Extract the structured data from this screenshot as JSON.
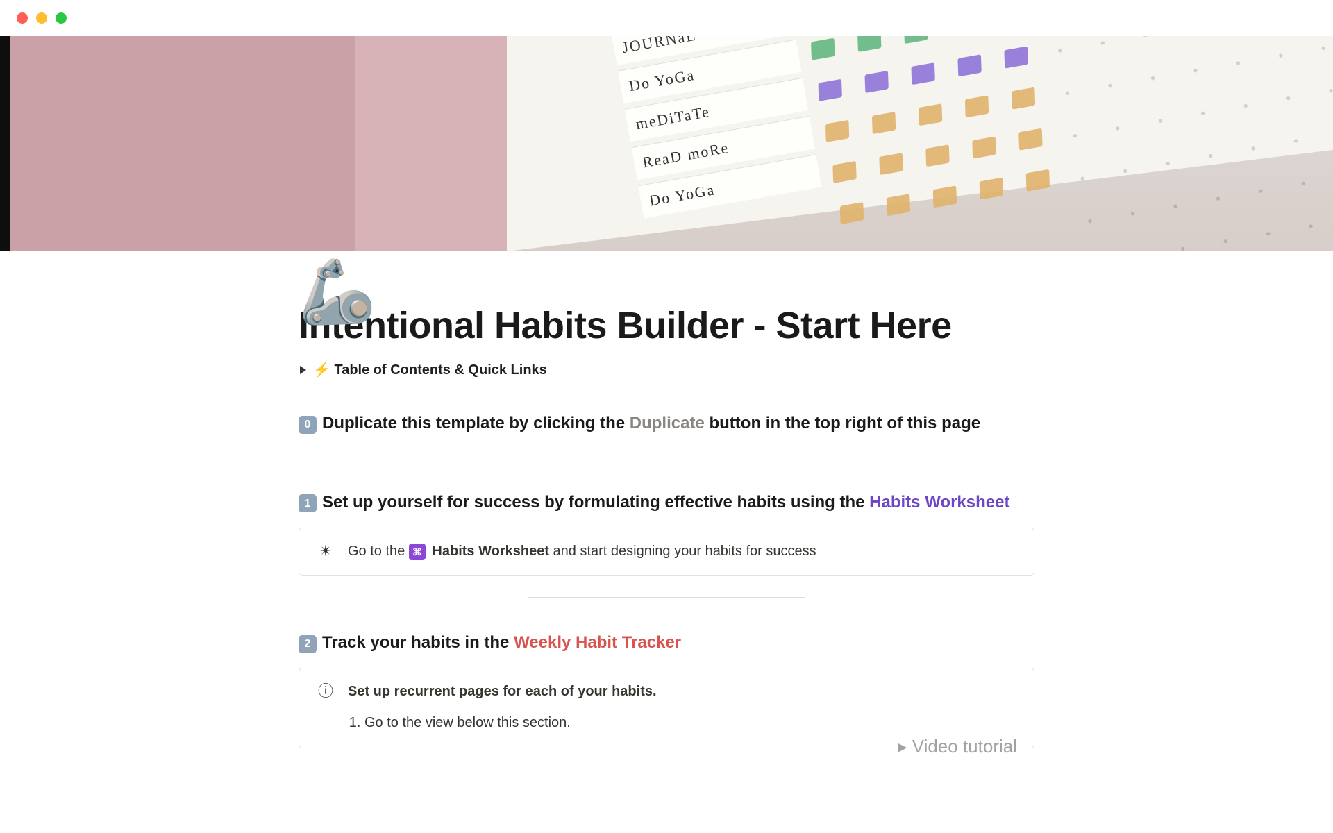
{
  "cover": {
    "journal_words": [
      "JOURNaL",
      "Do YoGa",
      "meDiTaTe",
      "ReaD moRe",
      "Do YoGa"
    ]
  },
  "page_icon": "🦾",
  "page_title": "Intentional Habits Builder - Start Here",
  "toc_toggle": "⚡ Table of Contents & Quick Links",
  "step0": {
    "num": "0",
    "pre": "Duplicate this template by clicking the ",
    "kw": "Duplicate",
    "post": " button in the top right of this page"
  },
  "step1": {
    "num": "1",
    "pre": "Set up yourself for success by formulating effective habits using the ",
    "link": "Habits Worksheet"
  },
  "step1_callout": {
    "lead": "Go to the ",
    "ws_name": "Habits Worksheet",
    "tail": " and start designing your habits for success"
  },
  "step2": {
    "num": "2",
    "pre": "Track your habits in the ",
    "link": "Weekly Habit Tracker"
  },
  "step2_callout": {
    "heading": "Set up recurrent pages for each of your habits.",
    "list_1": "Go to the view below this section."
  },
  "video_stub": "▸ Video  tutorial"
}
